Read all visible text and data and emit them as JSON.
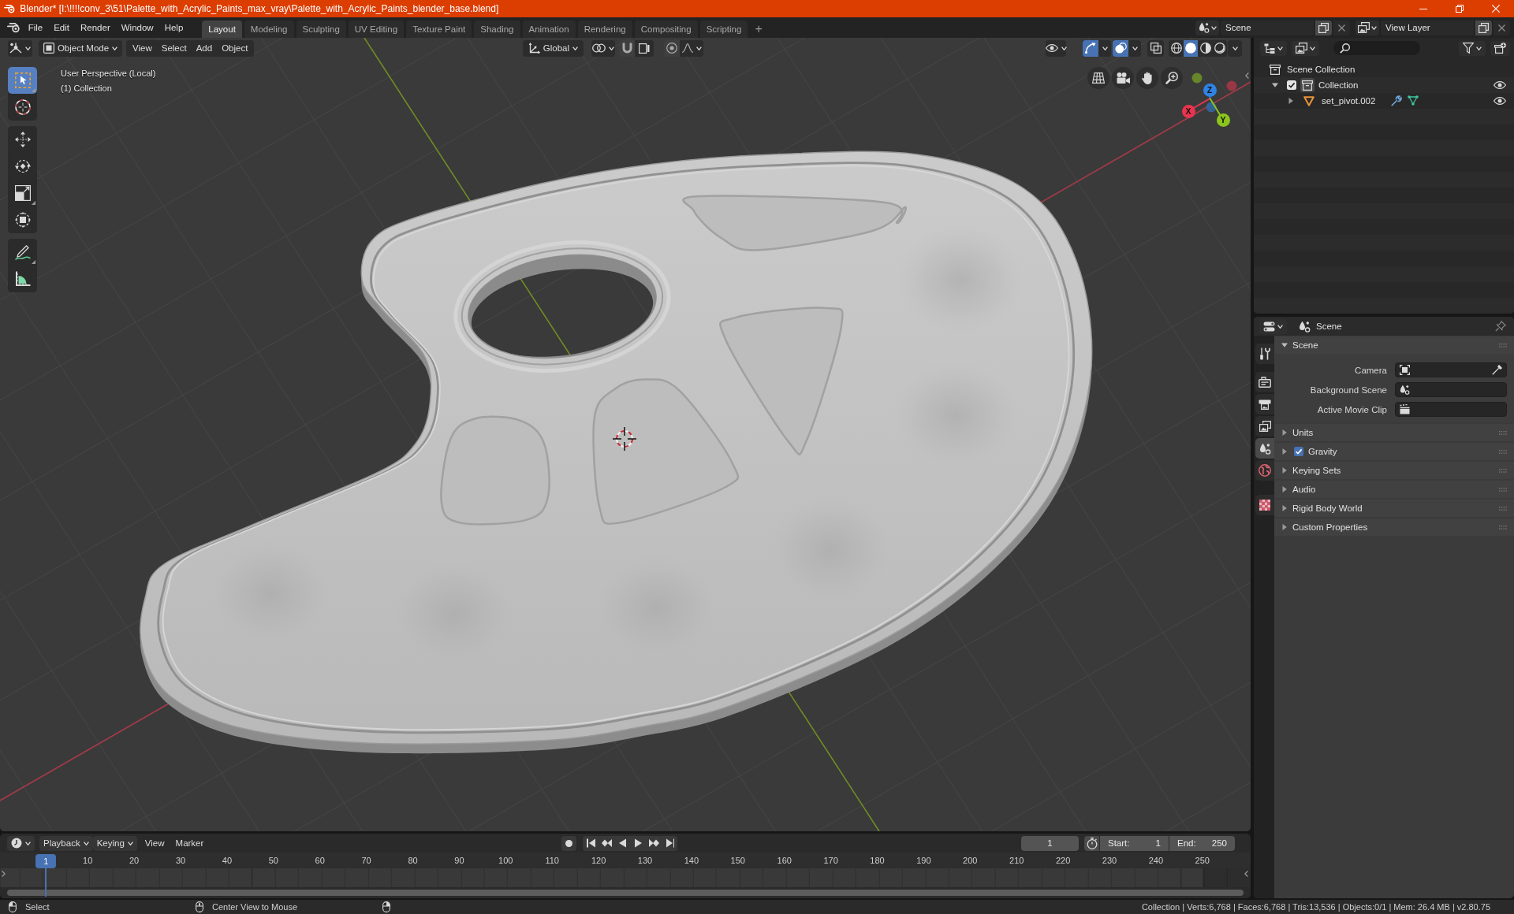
{
  "window": {
    "title": "Blender* [I:\\!!!!conv_3\\51\\Palette_with_Acrylic_Paints_max_vray\\Palette_with_Acrylic_Paints_blender_base.blend]"
  },
  "topbar": {
    "menus": [
      "File",
      "Edit",
      "Render",
      "Window",
      "Help"
    ],
    "workspaces": [
      {
        "label": "Layout",
        "selected": true
      },
      {
        "label": "Modeling",
        "selected": false
      },
      {
        "label": "Sculpting",
        "selected": false
      },
      {
        "label": "UV Editing",
        "selected": false
      },
      {
        "label": "Texture Paint",
        "selected": false
      },
      {
        "label": "Shading",
        "selected": false
      },
      {
        "label": "Animation",
        "selected": false
      },
      {
        "label": "Rendering",
        "selected": false
      },
      {
        "label": "Compositing",
        "selected": false
      },
      {
        "label": "Scripting",
        "selected": false
      }
    ],
    "add_workspace": "+",
    "scene": "Scene",
    "view_layer": "View Layer"
  },
  "viewport": {
    "mode": "Object Mode",
    "menus": [
      "View",
      "Select",
      "Add",
      "Object"
    ],
    "orientation": "Global",
    "toggles": [
      {
        "kind": "gizmos",
        "on": true
      },
      {
        "kind": "overlays",
        "on": true
      },
      {
        "kind": "xray",
        "on": false
      }
    ],
    "shading": [
      {
        "kind": "wireframe",
        "selected": false
      },
      {
        "kind": "solid",
        "selected": true
      },
      {
        "kind": "material",
        "selected": false
      },
      {
        "kind": "rendered",
        "selected": false
      }
    ],
    "info": [
      "User Perspective (Local)",
      "(1) Collection"
    ],
    "tool_groups": [
      {
        "tools": [
          {
            "kind": "select_box",
            "selected": true
          },
          {
            "kind": "cursor",
            "selected": false
          }
        ]
      },
      {
        "tools": [
          {
            "kind": "move",
            "selected": false
          },
          {
            "kind": "rotate",
            "selected": false
          },
          {
            "kind": "scale",
            "selected": false
          },
          {
            "kind": "transform",
            "selected": false
          }
        ]
      },
      {
        "tools": [
          {
            "kind": "annotate",
            "selected": false
          },
          {
            "kind": "measure",
            "selected": false
          }
        ]
      }
    ],
    "gizmo_axes": [
      {
        "kind": "z",
        "label": "Z",
        "color": "#2f84e3"
      },
      {
        "kind": "x",
        "label": "X",
        "color": "#e8344e"
      },
      {
        "kind": "y",
        "label": "Y",
        "color": "#8bc41d"
      }
    ]
  },
  "outliner": {
    "tree": [
      {
        "label": "Scene Collection",
        "kind": "scene_collection",
        "children": [
          {
            "label": "Collection",
            "kind": "collection",
            "expanded": true,
            "checked": true,
            "active": true,
            "visible": true,
            "children": [
              {
                "label": "set_pivot.002",
                "kind": "mesh_object",
                "expanded": false,
                "visible": true,
                "badges": [
                  {
                    "kind": "modifier"
                  },
                  {
                    "kind": "mesh_data"
                  }
                ]
              }
            ]
          }
        ]
      }
    ]
  },
  "properties": {
    "context": "Scene",
    "tab_groups": [
      {
        "tabs": [
          {
            "kind": "tool",
            "selected": false
          }
        ]
      },
      {
        "tabs": [
          {
            "kind": "render",
            "selected": false
          },
          {
            "kind": "output",
            "selected": false
          },
          {
            "kind": "view_layer",
            "selected": false
          },
          {
            "kind": "scene",
            "selected": true
          },
          {
            "kind": "world",
            "selected": false
          }
        ]
      },
      {
        "tabs": [
          {
            "kind": "texture",
            "selected": false
          }
        ]
      }
    ],
    "panels": [
      {
        "label": "Scene",
        "expanded": true,
        "fields": [
          {
            "label": "Camera",
            "kind": "camera"
          },
          {
            "label": "Background Scene",
            "kind": "scene"
          },
          {
            "label": "Active Movie Clip",
            "kind": "movie_clip"
          }
        ]
      },
      {
        "label": "Units",
        "expanded": false
      },
      {
        "label": "Gravity",
        "expanded": false,
        "checked": true
      },
      {
        "label": "Keying Sets",
        "expanded": false
      },
      {
        "label": "Audio",
        "expanded": false
      },
      {
        "label": "Rigid Body World",
        "expanded": false
      },
      {
        "label": "Custom Properties",
        "expanded": false
      }
    ]
  },
  "timeline": {
    "menus": [
      {
        "label": "Playback",
        "kind": "dropdown"
      },
      {
        "label": "Keying",
        "kind": "dropdown"
      },
      {
        "label": "View",
        "kind": "menu"
      },
      {
        "label": "Marker",
        "kind": "menu"
      }
    ],
    "current_frame": "1",
    "start_label": "Start:",
    "start": "1",
    "end_label": "End:",
    "end": "250",
    "playhead": "1",
    "ticks": [
      "10",
      "20",
      "30",
      "40",
      "50",
      "60",
      "70",
      "80",
      "90",
      "100",
      "110",
      "120",
      "130",
      "140",
      "150",
      "160",
      "170",
      "180",
      "190",
      "200",
      "210",
      "220",
      "230",
      "240",
      "250"
    ]
  },
  "status_bar": {
    "hints": [
      {
        "kind": "left",
        "label": "Select"
      },
      {
        "kind": "middle",
        "label": "Center View to Mouse"
      },
      {
        "kind": "right"
      }
    ],
    "stats": "Collection | Verts:6,768 | Faces:6,768 | Tris:13,536 | Objects:0/1 | Mem: 26.4 MB | v2.80.75"
  }
}
